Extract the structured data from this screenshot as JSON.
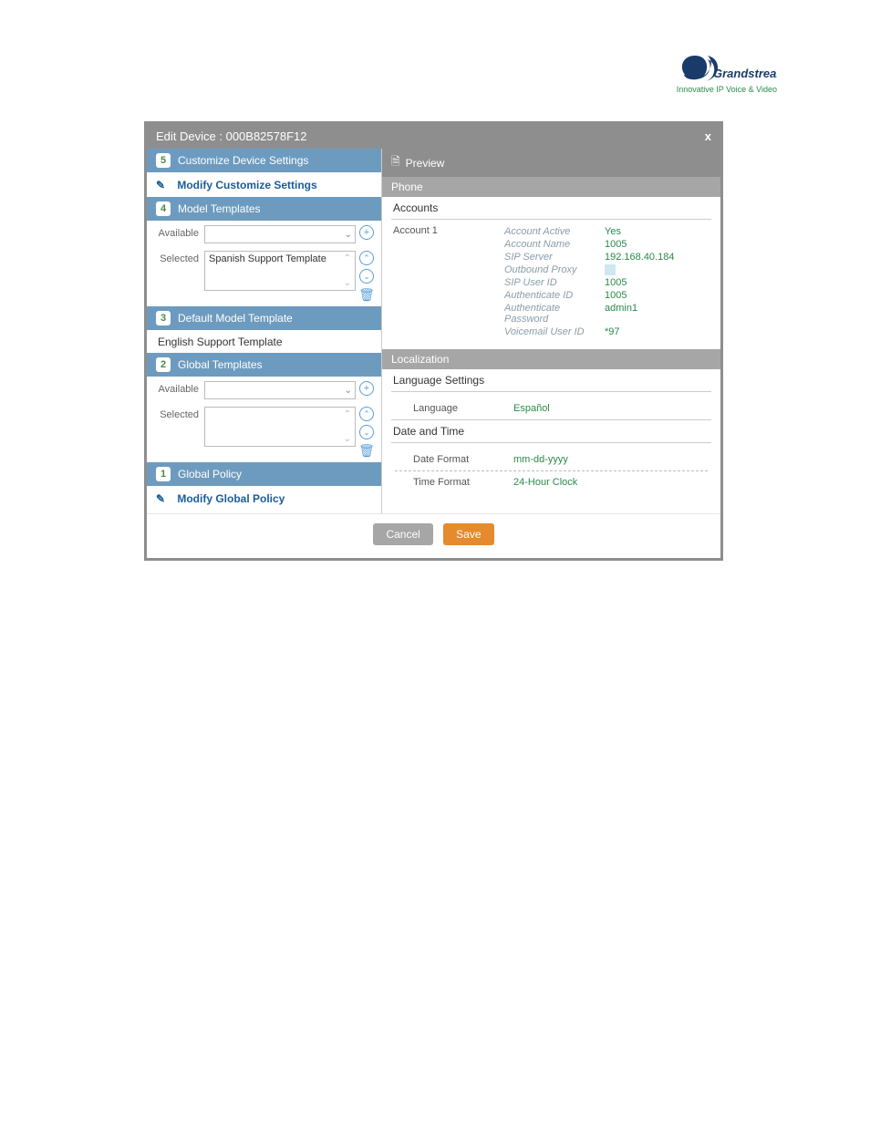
{
  "logo": {
    "brand": "Grandstream",
    "tagline": "Innovative IP Voice & Video"
  },
  "modal": {
    "title": "Edit Device : 000B82578F12",
    "close": "x"
  },
  "left": {
    "customize": {
      "badge": "5",
      "title": "Customize Device Settings",
      "modify": "Modify Customize Settings"
    },
    "model_templates": {
      "badge": "4",
      "title": "Model Templates",
      "available_label": "Available",
      "selected_label": "Selected",
      "selected_value": "Spanish Support Template"
    },
    "default_model": {
      "badge": "3",
      "title": "Default Model Template",
      "value": "English Support Template"
    },
    "global_templates": {
      "badge": "2",
      "title": "Global Templates",
      "available_label": "Available",
      "selected_label": "Selected"
    },
    "global_policy": {
      "badge": "1",
      "title": "Global Policy",
      "modify": "Modify Global Policy"
    }
  },
  "right": {
    "preview": "Preview",
    "phone": "Phone",
    "accounts": "Accounts",
    "account1": "Account 1",
    "kv": {
      "account_active": {
        "k": "Account Active",
        "v": "Yes"
      },
      "account_name": {
        "k": "Account Name",
        "v": "1005"
      },
      "sip_server": {
        "k": "SIP Server",
        "v": "192.168.40.184"
      },
      "outbound_proxy": {
        "k": "Outbound Proxy",
        "v": ""
      },
      "sip_user_id": {
        "k": "SIP User ID",
        "v": "1005"
      },
      "auth_id": {
        "k": "Authenticate ID",
        "v": "1005"
      },
      "auth_pw": {
        "k": "Authenticate Password",
        "v": "admin1"
      },
      "vm_user": {
        "k": "Voicemail User ID",
        "v": "*97"
      }
    },
    "localization": "Localization",
    "lang_settings": "Language Settings",
    "language": {
      "k": "Language",
      "v": "Español"
    },
    "date_time": "Date and Time",
    "date_format": {
      "k": "Date Format",
      "v": "mm-dd-yyyy"
    },
    "time_format": {
      "k": "Time Format",
      "v": "24-Hour Clock"
    }
  },
  "footer": {
    "cancel": "Cancel",
    "save": "Save"
  },
  "caption": ""
}
